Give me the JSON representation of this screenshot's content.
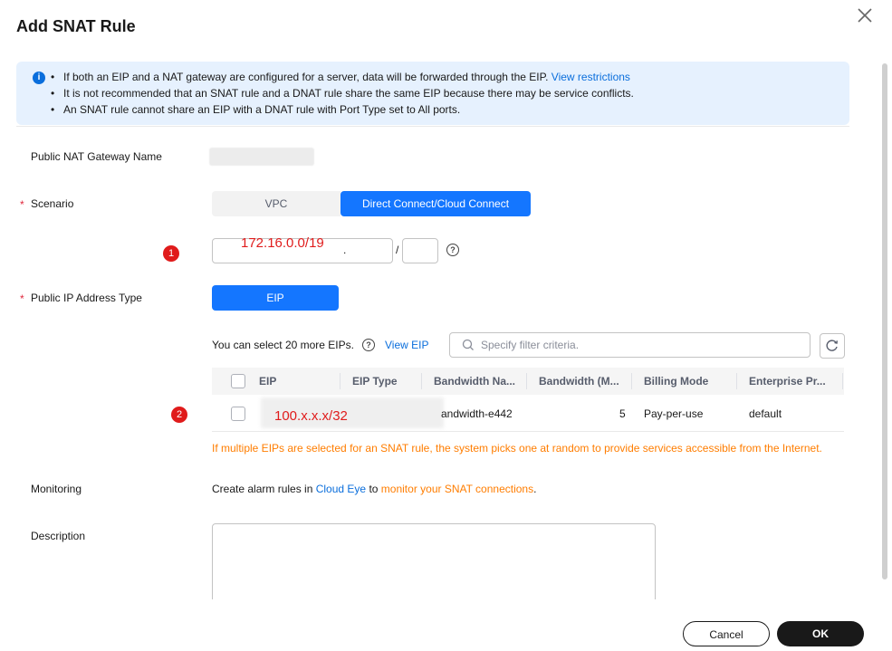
{
  "dialog": {
    "title": "Add SNAT Rule",
    "close_icon": "close-icon"
  },
  "alert": {
    "icon": "info-icon",
    "lines": [
      "If both an EIP and a NAT gateway are configured for a server, data will be forwarded through the EIP.",
      "It is not recommended that an SNAT rule and a DNAT rule share the same EIP because there may be service conflicts.",
      "An SNAT rule cannot share an EIP with a DNAT rule with Port Type set to All ports."
    ],
    "link": "View restrictions"
  },
  "form": {
    "gateway_label": "Public NAT Gateway Name",
    "scenario_label": "Scenario",
    "scenario_options": [
      "VPC",
      "Direct Connect/Cloud Connect"
    ],
    "scenario_selected": "Direct Connect/Cloud Connect",
    "cidr_badge": "1",
    "cidr_value": "172.16.0.0/19",
    "cidr_dot": ".",
    "cidr_slash": "/",
    "public_ip_label": "Public IP Address Type",
    "public_ip_button": "EIP",
    "eip_count_text": "You can select 20 more EIPs.",
    "view_eip": "View EIP",
    "search_placeholder": "Specify filter criteria.",
    "monitoring_label": "Monitoring",
    "monitoring_prefix": "Create alarm rules in",
    "cloud_eye": "Cloud Eye",
    "monitoring_mid": "to",
    "monitor_link": "monitor your SNAT connections",
    "monitoring_end": ".",
    "description_label": "Description"
  },
  "table": {
    "columns": [
      "EIP",
      "EIP Type",
      "Bandwidth Na...",
      "Bandwidth (M...",
      "Billing Mode",
      "Enterprise Pr..."
    ],
    "rows": [
      {
        "badge": "2",
        "eip": "100.x.x.x/32",
        "bandwidth_name": "andwidth-e442",
        "bandwidth": "5",
        "billing": "Pay-per-use",
        "enterprise": "default"
      }
    ],
    "warning": "If multiple EIPs are selected for an SNAT rule, the system picks one at random to provide services accessible from the Internet."
  },
  "footer": {
    "cancel": "Cancel",
    "ok": "OK"
  }
}
